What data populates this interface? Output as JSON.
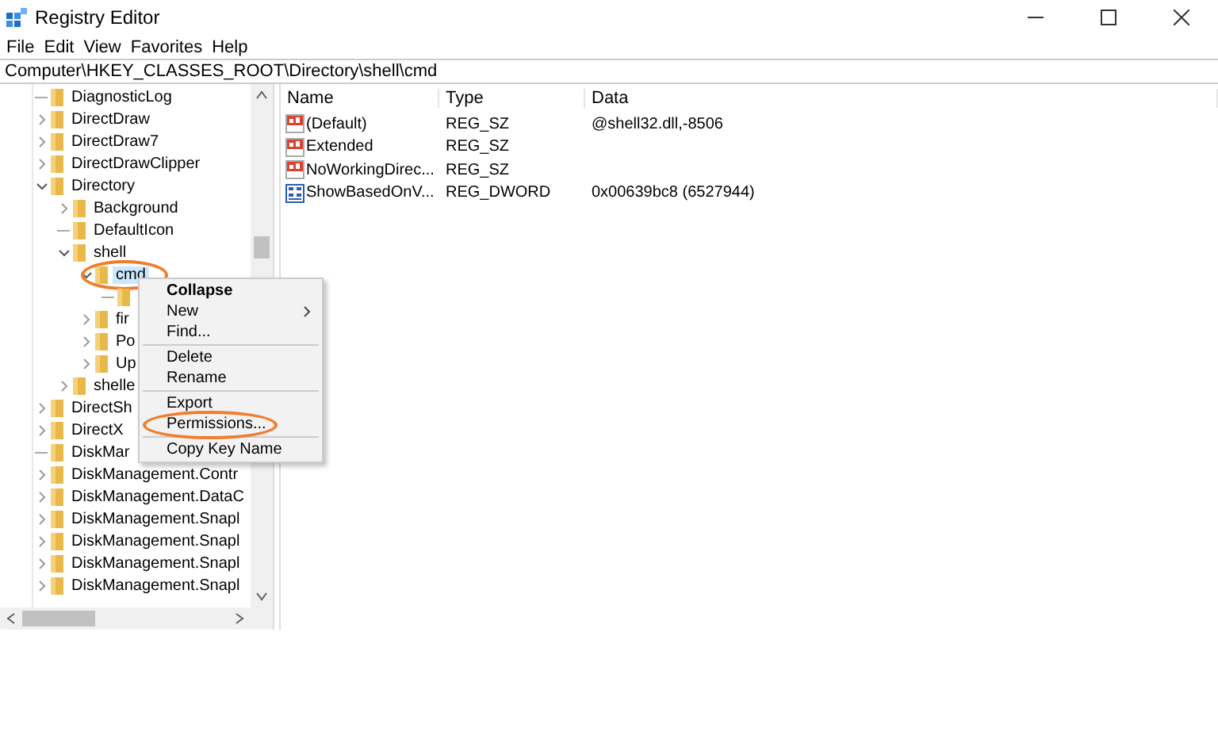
{
  "window": {
    "title": "Registry Editor"
  },
  "menu_bar": [
    "File",
    "Edit",
    "View",
    "Favorites",
    "Help"
  ],
  "address": "Computer\\HKEY_CLASSES_ROOT\\Directory\\shell\\cmd",
  "tree": [
    {
      "label": "DiagnosticLog",
      "kind": "leaf",
      "selected": false,
      "highlighted": false
    },
    {
      "label": "DirectDraw",
      "kind": "branch",
      "expanded": false,
      "selected": false,
      "highlighted": false
    },
    {
      "label": "DirectDraw7",
      "kind": "branch",
      "expanded": false,
      "selected": false,
      "highlighted": false
    },
    {
      "label": "DirectDrawClipper",
      "kind": "branch",
      "expanded": false,
      "selected": false,
      "highlighted": false
    },
    {
      "label": "Directory",
      "kind": "branch",
      "expanded": true,
      "selected": false,
      "highlighted": false,
      "children": [
        {
          "label": "Background",
          "kind": "branch",
          "expanded": false,
          "selected": false,
          "highlighted": false
        },
        {
          "label": "DefaultIcon",
          "kind": "leaf",
          "selected": false,
          "highlighted": false
        },
        {
          "label": "shell",
          "kind": "branch",
          "expanded": true,
          "selected": false,
          "highlighted": false,
          "children": [
            {
              "label": "cmd",
              "kind": "branch",
              "expanded": true,
              "selected": true,
              "highlighted": true,
              "children": [
                {
                  "kind": "leaf"
                }
              ]
            },
            {
              "label": "fir",
              "kind": "branch",
              "expanded": false,
              "selected": false,
              "highlighted": false
            },
            {
              "label": "Po",
              "kind": "branch",
              "expanded": false,
              "selected": false,
              "highlighted": false
            },
            {
              "label": "Up",
              "kind": "branch",
              "expanded": false,
              "selected": false,
              "highlighted": false
            }
          ]
        },
        {
          "label": "shelle",
          "kind": "branch",
          "expanded": false,
          "selected": false,
          "highlighted": false
        }
      ]
    },
    {
      "label": "DirectSh",
      "kind": "branch",
      "expanded": false,
      "selected": false,
      "highlighted": false
    },
    {
      "label": "DirectX",
      "kind": "branch",
      "expanded": false,
      "selected": false,
      "highlighted": false
    },
    {
      "label": "DiskMar",
      "kind": "leaf",
      "selected": false,
      "highlighted": false
    },
    {
      "label": "DiskManagement.Contr",
      "kind": "branch",
      "expanded": false,
      "selected": false,
      "highlighted": false
    },
    {
      "label": "DiskManagement.DataC",
      "kind": "branch",
      "expanded": false,
      "selected": false,
      "highlighted": false
    },
    {
      "label": "DiskManagement.Snapl",
      "kind": "branch",
      "expanded": false,
      "selected": false,
      "highlighted": false
    },
    {
      "label": "DiskManagement.Snapl",
      "kind": "branch",
      "expanded": false,
      "selected": false,
      "highlighted": false
    },
    {
      "label": "DiskManagement.Snapl",
      "kind": "branch",
      "expanded": false,
      "selected": false,
      "highlighted": false
    },
    {
      "label": "DiskManagement.Snapl",
      "kind": "branch",
      "expanded": false,
      "selected": false,
      "highlighted": false
    }
  ],
  "values": {
    "columns": [
      "Name",
      "Type",
      "Data"
    ],
    "rows": [
      {
        "kind": "string",
        "name": "(Default)",
        "type": "REG_SZ",
        "data": "@shell32.dll,-8506"
      },
      {
        "kind": "string",
        "name": "Extended",
        "type": "REG_SZ"
      },
      {
        "kind": "string",
        "name": "NoWorkingDirec...",
        "type": "REG_SZ"
      },
      {
        "kind": "binary",
        "name": "ShowBasedOnV...",
        "type": "REG_DWORD",
        "data": "0x00639bc8 (6527944)"
      }
    ]
  },
  "context_menu": {
    "groups": [
      [
        {
          "label": "Collapse",
          "default": true,
          "submenu": false,
          "highlighted": false
        },
        {
          "label": "New",
          "default": false,
          "submenu": true,
          "highlighted": false
        },
        {
          "label": "Find...",
          "default": false,
          "submenu": false,
          "highlighted": false
        }
      ],
      [
        {
          "label": "Delete",
          "default": false,
          "submenu": false,
          "highlighted": false
        },
        {
          "label": "Rename",
          "default": false,
          "submenu": false,
          "highlighted": false
        }
      ],
      [
        {
          "label": "Export",
          "default": false,
          "submenu": false,
          "highlighted": false
        },
        {
          "label": "Permissions...",
          "default": false,
          "submenu": false,
          "highlighted": true
        }
      ],
      [
        {
          "label": "Copy Key Name",
          "default": false,
          "submenu": false,
          "highlighted": false
        }
      ]
    ]
  }
}
